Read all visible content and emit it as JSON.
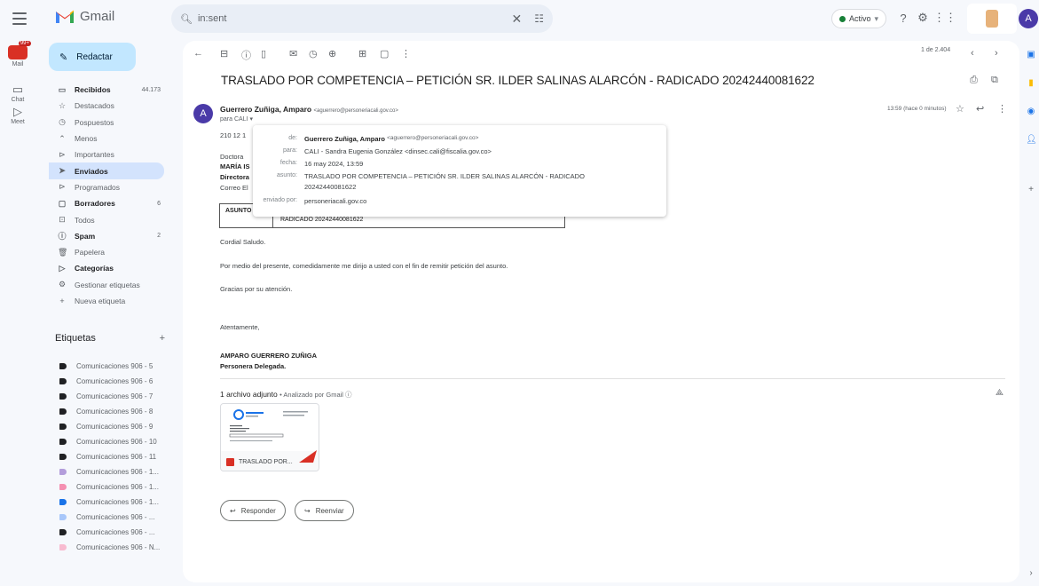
{
  "app": {
    "name": "Gmail"
  },
  "search": {
    "query": "in:sent"
  },
  "status": {
    "label": "Activo"
  },
  "rail": [
    {
      "label": "Mail",
      "badge": "99+"
    },
    {
      "label": "Chat"
    },
    {
      "label": "Meet"
    }
  ],
  "compose": {
    "label": "Redactar"
  },
  "nav": [
    {
      "label": "Recibidos",
      "count": "44.173",
      "icon": "inbox-icon",
      "glyph": "▭",
      "bold": true
    },
    {
      "label": "Destacados",
      "icon": "star-icon",
      "glyph": "☆"
    },
    {
      "label": "Pospuestos",
      "icon": "clock-icon",
      "glyph": "◷"
    },
    {
      "label": "Menos",
      "icon": "chevron-up-icon",
      "glyph": "⌃"
    },
    {
      "label": "Importantes",
      "icon": "important-icon",
      "glyph": "⊳"
    },
    {
      "label": "Enviados",
      "icon": "send-icon",
      "glyph": "➤",
      "active": true
    },
    {
      "label": "Programados",
      "icon": "scheduled-icon",
      "glyph": "⊳"
    },
    {
      "label": "Borradores",
      "count": "6",
      "icon": "draft-icon",
      "glyph": "▢",
      "bold": true
    },
    {
      "label": "Todos",
      "icon": "all-mail-icon",
      "glyph": "⊡"
    },
    {
      "label": "Spam",
      "count": "2",
      "icon": "spam-icon",
      "glyph": "ⓘ",
      "bold": true
    },
    {
      "label": "Papelera",
      "icon": "trash-icon",
      "glyph": "🗑"
    },
    {
      "label": "Categorías",
      "icon": "category-icon",
      "glyph": "▷",
      "bold": true
    },
    {
      "label": "Gestionar etiquetas",
      "icon": "settings-icon",
      "glyph": "⚙"
    },
    {
      "label": "Nueva etiqueta",
      "icon": "plus-icon",
      "glyph": "+"
    }
  ],
  "labels_title": "Etiquetas",
  "labels": [
    {
      "label": "Comunicaciones 906 - 5",
      "color": "#202124"
    },
    {
      "label": "Comunicaciones 906 - 6",
      "color": "#202124"
    },
    {
      "label": "Comunicaciones 906 - 7",
      "color": "#202124"
    },
    {
      "label": "Comunicaciones 906 - 8",
      "color": "#202124"
    },
    {
      "label": "Comunicaciones 906 - 9",
      "color": "#202124"
    },
    {
      "label": "Comunicaciones 906 - 10",
      "color": "#202124"
    },
    {
      "label": "Comunicaciones 906 - 11",
      "color": "#202124"
    },
    {
      "label": "Comunicaciones 906 - 1...",
      "color": "#b39ddb"
    },
    {
      "label": "Comunicaciones 906 - 1...",
      "color": "#f48fb1"
    },
    {
      "label": "Comunicaciones 906 - 1...",
      "color": "#1a73e8"
    },
    {
      "label": "Comunicaciones 906 - ...",
      "color": "#a8c7fa"
    },
    {
      "label": "Comunicaciones 906 - ...",
      "color": "#202124"
    },
    {
      "label": "Comunicaciones 906 - N...",
      "color": "#f8bbd0"
    }
  ],
  "toolbar": {
    "page_count": "1 de 2.404"
  },
  "email": {
    "subject": "TRASLADO POR COMPETENCIA – PETICIÓN SR. ILDER SALINAS ALARCÓN - RADICADO 20242440081622",
    "sender_initial": "A",
    "sender_name": "Guerrero Zuñiga, Amparo",
    "sender_email": "<aguerrero@personeriacali.gov.co>",
    "to": "para CALI ▾",
    "time": "13:59 (hace 0 minutos)",
    "ref": "210 12 1",
    "doctora": "Doctora",
    "maria": "MARÍA IS",
    "directora": "Directora",
    "correo": "Correo El",
    "asunto_label": "ASUNTO",
    "asunto_value": "RADICADO 20242440081622",
    "greeting": "Cordial Saludo.",
    "para1": "Por medio del presente, comedidamente me dirijo a usted con el fin de remitir petición del asunto.",
    "para2": "Gracias por su atención.",
    "closing": "Atentamente,",
    "sig_name": "AMPARO GUERRERO ZUÑIGA",
    "sig_title": "Personera Delegada."
  },
  "popup": {
    "de_k": "de:",
    "de_v": "Guerrero Zuñiga, Amparo",
    "de_e": "<aguerrero@personeriacali.gov.co>",
    "para_k": "para:",
    "para_v": "CALI - Sandra Eugenia González <dinsec.cali@fiscalia.gov.co>",
    "fecha_k": "fecha:",
    "fecha_v": "16 may 2024, 13:59",
    "asunto_k": "asunto:",
    "asunto_v": "TRASLADO POR COMPETENCIA – PETICIÓN SR. ILDER SALINAS ALARCÓN - RADICADO",
    "asunto_v2": "20242440081622",
    "env_k": "enviado por:",
    "env_v": "personeriacali.gov.co"
  },
  "attachments": {
    "header": "1 archivo adjunto",
    "sub": "• Analizado por Gmail ⓘ",
    "file_name": "TRASLADO POR..."
  },
  "actions": {
    "reply": "Responder",
    "forward": "Reenviar"
  }
}
